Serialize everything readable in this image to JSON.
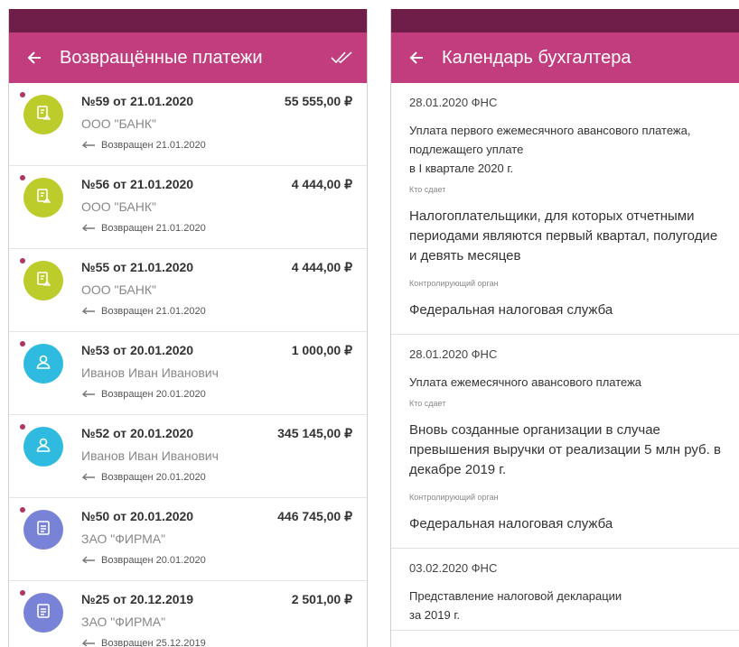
{
  "left_screen": {
    "title": "Возвращённые платежи",
    "payments": [
      {
        "number": "№59 от 21.01.2020",
        "amount": "55 555,00 ₽",
        "org": "ООО \"БАНК\"",
        "returned": "Возвращен 21.01.2020",
        "icon": "document-icon",
        "color": "#bccc2b"
      },
      {
        "number": "№56 от 21.01.2020",
        "amount": "4 444,00 ₽",
        "org": "ООО \"БАНК\"",
        "returned": "Возвращен 21.01.2020",
        "icon": "document-icon",
        "color": "#bccc2b"
      },
      {
        "number": "№55 от 21.01.2020",
        "amount": "4 444,00 ₽",
        "org": "ООО \"БАНК\"",
        "returned": "Возвращен 21.01.2020",
        "icon": "document-icon",
        "color": "#bccc2b"
      },
      {
        "number": "№53 от 20.01.2020",
        "amount": "1 000,00 ₽",
        "org": "Иванов Иван Иванович",
        "returned": "Возвращен 20.01.2020",
        "icon": "person-icon",
        "color": "#2fbbe0"
      },
      {
        "number": "№52 от 20.01.2020",
        "amount": "345 145,00 ₽",
        "org": "Иванов Иван Иванович",
        "returned": "Возвращен 20.01.2020",
        "icon": "person-icon",
        "color": "#2fbbe0"
      },
      {
        "number": "№50 от 20.01.2020",
        "amount": "446 745,00 ₽",
        "org": "ЗАО \"ФИРМА\"",
        "returned": "Возвращен 20.01.2020",
        "icon": "list-icon",
        "color": "#7882d6"
      },
      {
        "number": "№25 от 20.12.2019",
        "amount": "2 501,00 ₽",
        "org": "ЗАО \"ФИРМА\"",
        "returned": "Возвращен 25.12.2019",
        "icon": "list-icon",
        "color": "#7882d6"
      }
    ]
  },
  "right_screen": {
    "title": "Календарь бухгалтера",
    "events": [
      {
        "date": "28.01.2020 ФНС",
        "title": "Уплата первого ежемесячного авансового платежа,\nподлежащего уплате\nв I квартале 2020 г.",
        "who_label": "Кто сдает",
        "who": "Налогоплательщики, для которых отчетными периодами являются первый квартал, полугодие и девять месяцев",
        "authority_label": "Контролирующий орган",
        "authority": "Федеральная налоговая служба"
      },
      {
        "date": "28.01.2020 ФНС",
        "title": "Уплата ежемесячного авансового платежа",
        "who_label": "Кто сдает",
        "who": "Вновь созданные организации в случае превышения выручки от реализации 5 млн руб. в декабре 2019 г.",
        "authority_label": "Контролирующий орган",
        "authority": "Федеральная налоговая служба"
      },
      {
        "date": "03.02.2020 ФНС",
        "title": "Представление налоговой декларации\nза 2019 г.",
        "who_label": "",
        "who": "",
        "authority_label": "",
        "authority": ""
      }
    ]
  },
  "colors": {
    "status_bar": "#6e1e49",
    "app_bar": "#c23d7d",
    "unread_dot": "#b0365f"
  }
}
